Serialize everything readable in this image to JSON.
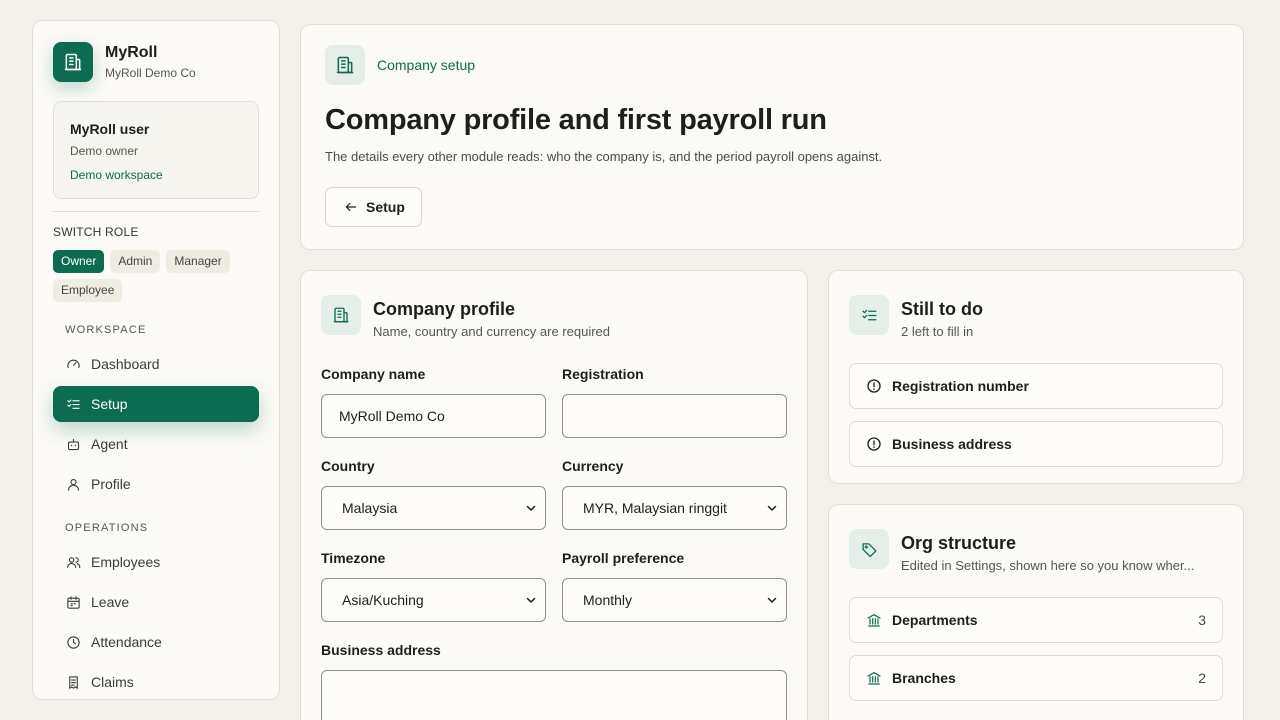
{
  "brand": {
    "name": "MyRoll",
    "company": "MyRoll Demo Co"
  },
  "user": {
    "name": "MyRoll user",
    "role": "Demo owner",
    "workspace": "Demo workspace"
  },
  "switch_role": {
    "title": "SWITCH ROLE",
    "roles": [
      "Owner",
      "Admin",
      "Manager",
      "Employee"
    ],
    "active": "Owner"
  },
  "nav": {
    "workspace_title": "WORKSPACE",
    "workspace_items": [
      "Dashboard",
      "Setup",
      "Agent",
      "Profile"
    ],
    "operations_title": "OPERATIONS",
    "operations_items": [
      "Employees",
      "Leave",
      "Attendance",
      "Claims"
    ],
    "active": "Setup"
  },
  "header": {
    "eyebrow": "Company setup",
    "title": "Company profile and first payroll run",
    "subtitle": "The details every other module reads: who the company is, and the period payroll opens against.",
    "back_label": "Setup"
  },
  "profile": {
    "title": "Company profile",
    "subtitle": "Name, country and currency are required",
    "company_name_label": "Company name",
    "company_name_value": "MyRoll Demo Co",
    "registration_label": "Registration",
    "registration_value": "",
    "country_label": "Country",
    "country_value": "Malaysia",
    "currency_label": "Currency",
    "currency_value": "MYR, Malaysian ringgit",
    "timezone_label": "Timezone",
    "timezone_value": "Asia/Kuching",
    "payroll_label": "Payroll preference",
    "payroll_value": "Monthly",
    "address_label": "Business address",
    "address_value": ""
  },
  "todo": {
    "title": "Still to do",
    "subtitle": "2 left to fill in",
    "items": [
      "Registration number",
      "Business address"
    ]
  },
  "org": {
    "title": "Org structure",
    "subtitle": "Edited in Settings, shown here so you know wher...",
    "items": [
      {
        "label": "Departments",
        "count": "3"
      },
      {
        "label": "Branches",
        "count": "2"
      }
    ]
  },
  "colors": {
    "accent": "#0d6b52",
    "background": "#f4f1ea",
    "card": "#fbfaf6",
    "tile": "#e5eee8"
  }
}
